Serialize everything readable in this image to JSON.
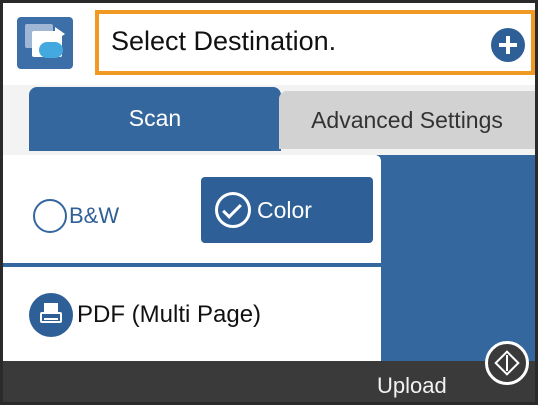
{
  "header": {
    "destination_text": "Select Destination.",
    "app_icon": "scan-to-cloud-icon",
    "add_icon": "plus-circle-icon"
  },
  "tabs": [
    {
      "label": "Scan",
      "selected": true
    },
    {
      "label": "Advanced Settings",
      "selected": false
    }
  ],
  "color_mode": {
    "options": [
      {
        "label": "B&W",
        "selected": false
      },
      {
        "label": "Color",
        "selected": true
      }
    ]
  },
  "format": {
    "label": "PDF (Multi Page)",
    "icon": "printer-document-icon"
  },
  "footer": {
    "upload_label": "Upload",
    "upload_icon": "start-diamond-icon"
  },
  "colors": {
    "accent": "#34679e",
    "highlight_border": "#f09a24",
    "footer": "#3a3a3a"
  }
}
